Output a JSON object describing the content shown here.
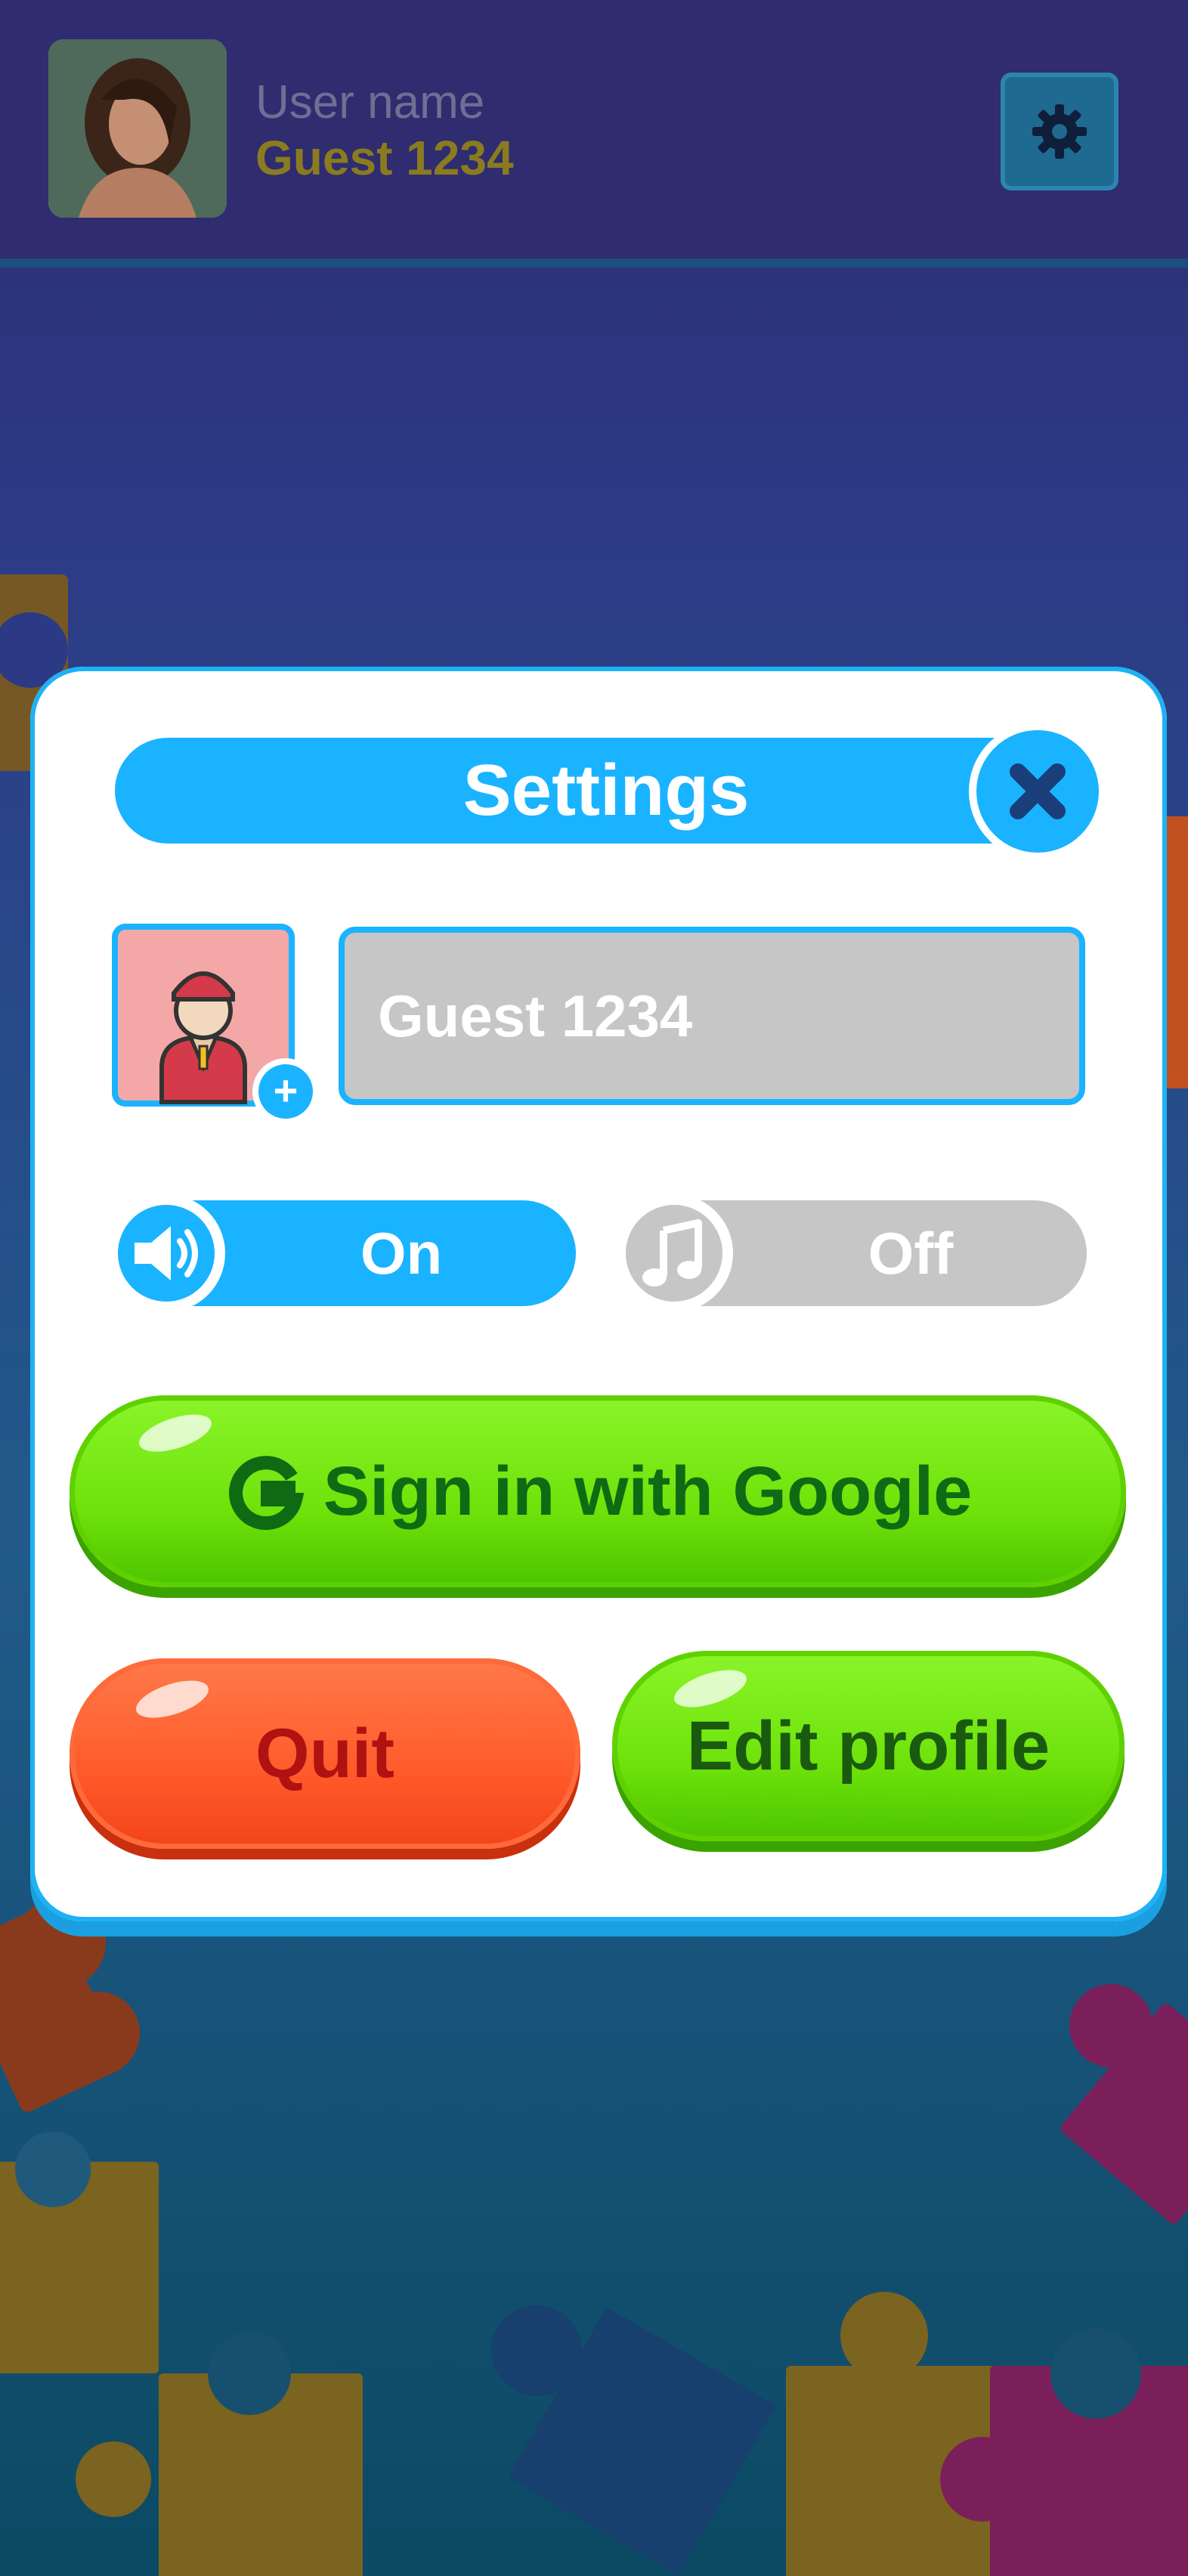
{
  "header": {
    "user_label": "User name",
    "user_name": "Guest 1234",
    "settings_icon": "gear-icon"
  },
  "dialog": {
    "title": "Settings",
    "close_icon": "close-icon",
    "name_value": "Guest 1234",
    "sound_toggle": {
      "icon": "speaker-icon",
      "label": "On",
      "state": "on"
    },
    "music_toggle": {
      "icon": "music-note-icon",
      "label": "Off",
      "state": "off"
    },
    "google_button": "Sign in with Google",
    "quit_button": "Quit",
    "edit_button": "Edit profile"
  },
  "colors": {
    "accent_blue": "#1ab3ff",
    "green": "#6ee20a",
    "red": "#ff5a2a",
    "header_bg": "#2f2c70",
    "off_gray": "#c6c6c6"
  }
}
